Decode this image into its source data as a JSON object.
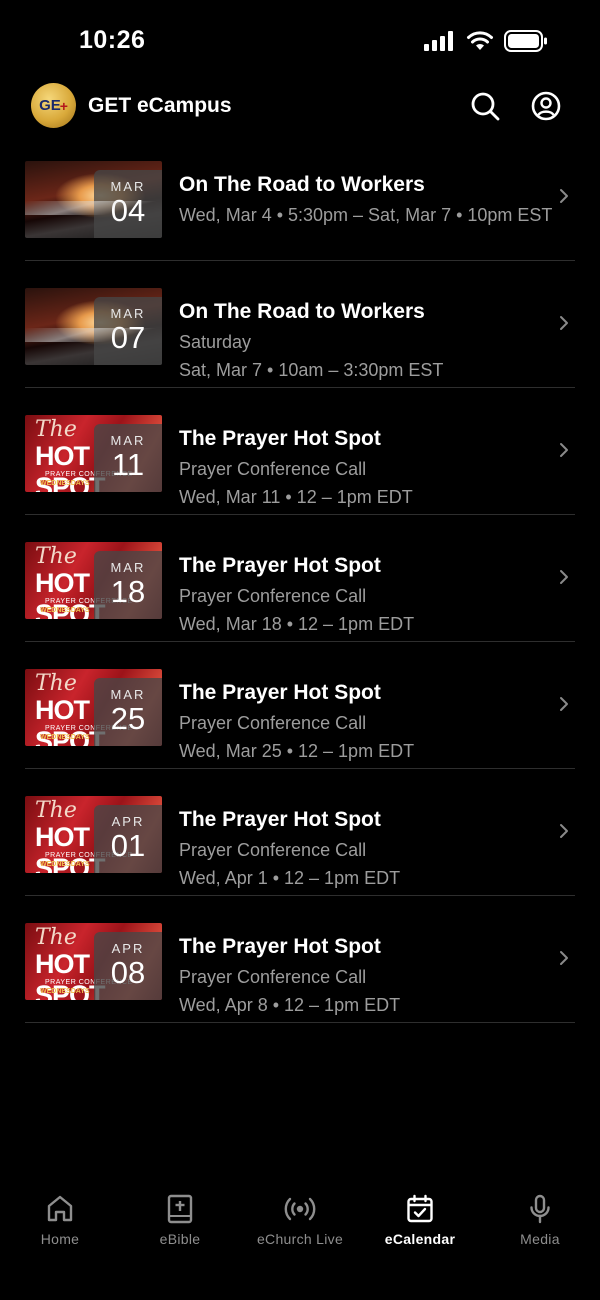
{
  "status_bar": {
    "time": "10:26"
  },
  "header": {
    "title": "GET eCampus",
    "logo_text": "GE",
    "logo_mark": "+"
  },
  "events": [
    {
      "thumb": "road",
      "month": "MAR",
      "day": "04",
      "title": "On The Road to Workers",
      "lines": [
        "Wed, Mar 4 • 5:30pm – Sat, Mar 7 • 10pm EST"
      ]
    },
    {
      "thumb": "road",
      "month": "MAR",
      "day": "07",
      "title": "On The Road to Workers",
      "lines": [
        "Saturday",
        "Sat, Mar 7 • 10am – 3:30pm EST"
      ]
    },
    {
      "thumb": "prayer",
      "month": "MAR",
      "day": "11",
      "title": "The Prayer Hot Spot",
      "lines": [
        "Prayer Conference Call",
        "Wed, Mar 11 • 12 – 1pm EDT"
      ]
    },
    {
      "thumb": "prayer",
      "month": "MAR",
      "day": "18",
      "title": "The Prayer Hot Spot",
      "lines": [
        "Prayer Conference Call",
        "Wed, Mar 18 • 12 – 1pm EDT"
      ]
    },
    {
      "thumb": "prayer",
      "month": "MAR",
      "day": "25",
      "title": "The Prayer Hot Spot",
      "lines": [
        "Prayer Conference Call",
        "Wed, Mar 25 • 12 – 1pm EDT"
      ]
    },
    {
      "thumb": "prayer",
      "month": "APR",
      "day": "01",
      "title": "The Prayer Hot Spot",
      "lines": [
        "Prayer Conference Call",
        "Wed, Apr 1 • 12 – 1pm EDT"
      ]
    },
    {
      "thumb": "prayer",
      "month": "APR",
      "day": "08",
      "title": "The Prayer Hot Spot",
      "lines": [
        "Prayer Conference Call",
        "Wed, Apr 8 • 12 – 1pm EDT"
      ]
    }
  ],
  "thumb_prayer": {
    "the": "The",
    "hot": "HOT SPOT",
    "sub1": "PRAYER CONFERENCE",
    "sub2": "WEDNESDAYS"
  },
  "tabs": [
    {
      "icon": "home-icon",
      "label": "Home",
      "active": false
    },
    {
      "icon": "bible-icon",
      "label": "eBible",
      "active": false
    },
    {
      "icon": "broadcast-icon",
      "label": "eChurch Live",
      "active": false
    },
    {
      "icon": "calendar-icon",
      "label": "eCalendar",
      "active": true
    },
    {
      "icon": "microphone-icon",
      "label": "Media",
      "active": false
    }
  ],
  "colors": {
    "background": "#000000",
    "secondary_text": "#9d9d9d",
    "divider": "#2e2e2e",
    "tab_inactive": "#8e8e8e"
  }
}
